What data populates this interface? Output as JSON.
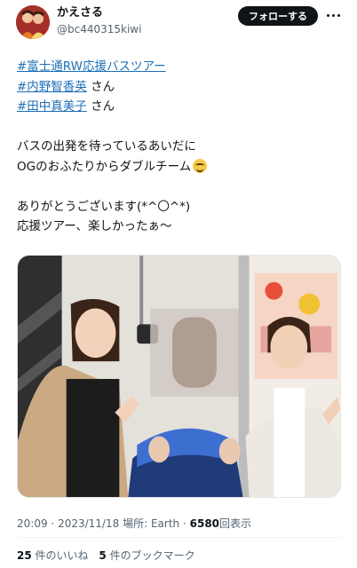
{
  "author": {
    "display_name": "かえさる",
    "handle": "@bc440315kiwi",
    "avatar_icon": "profile-avatar"
  },
  "actions": {
    "follow_label": "フォローする",
    "more_icon": "more-dots-icon"
  },
  "tweet": {
    "hashtags": [
      "#富士通RW応援バスツアー",
      "#内野智香英",
      "#田中真美子"
    ],
    "san": "さん",
    "line4": "バスの出発を待っているあいだに",
    "line5": "OGのおふたりからダブルチーム",
    "emoji": "grinning-sweat-emoji",
    "line7": "ありがとうございます(*^〇^*)",
    "line8": "応援ツアー、楽しかったぁ〜"
  },
  "meta": {
    "time": "20:09",
    "dot1": "·",
    "date": "2023/11/18",
    "location_label": "場所:",
    "location": "Earth",
    "dot2": "·",
    "views": "6580",
    "views_label": "回表示"
  },
  "stats": {
    "likes_count": "25",
    "likes_label": "件のいいね",
    "bookmarks_count": "5",
    "bookmarks_label": "件のブックマーク"
  },
  "colors": {
    "link": "#1d6fb8",
    "button_bg": "#0f1419",
    "muted": "#536471"
  }
}
